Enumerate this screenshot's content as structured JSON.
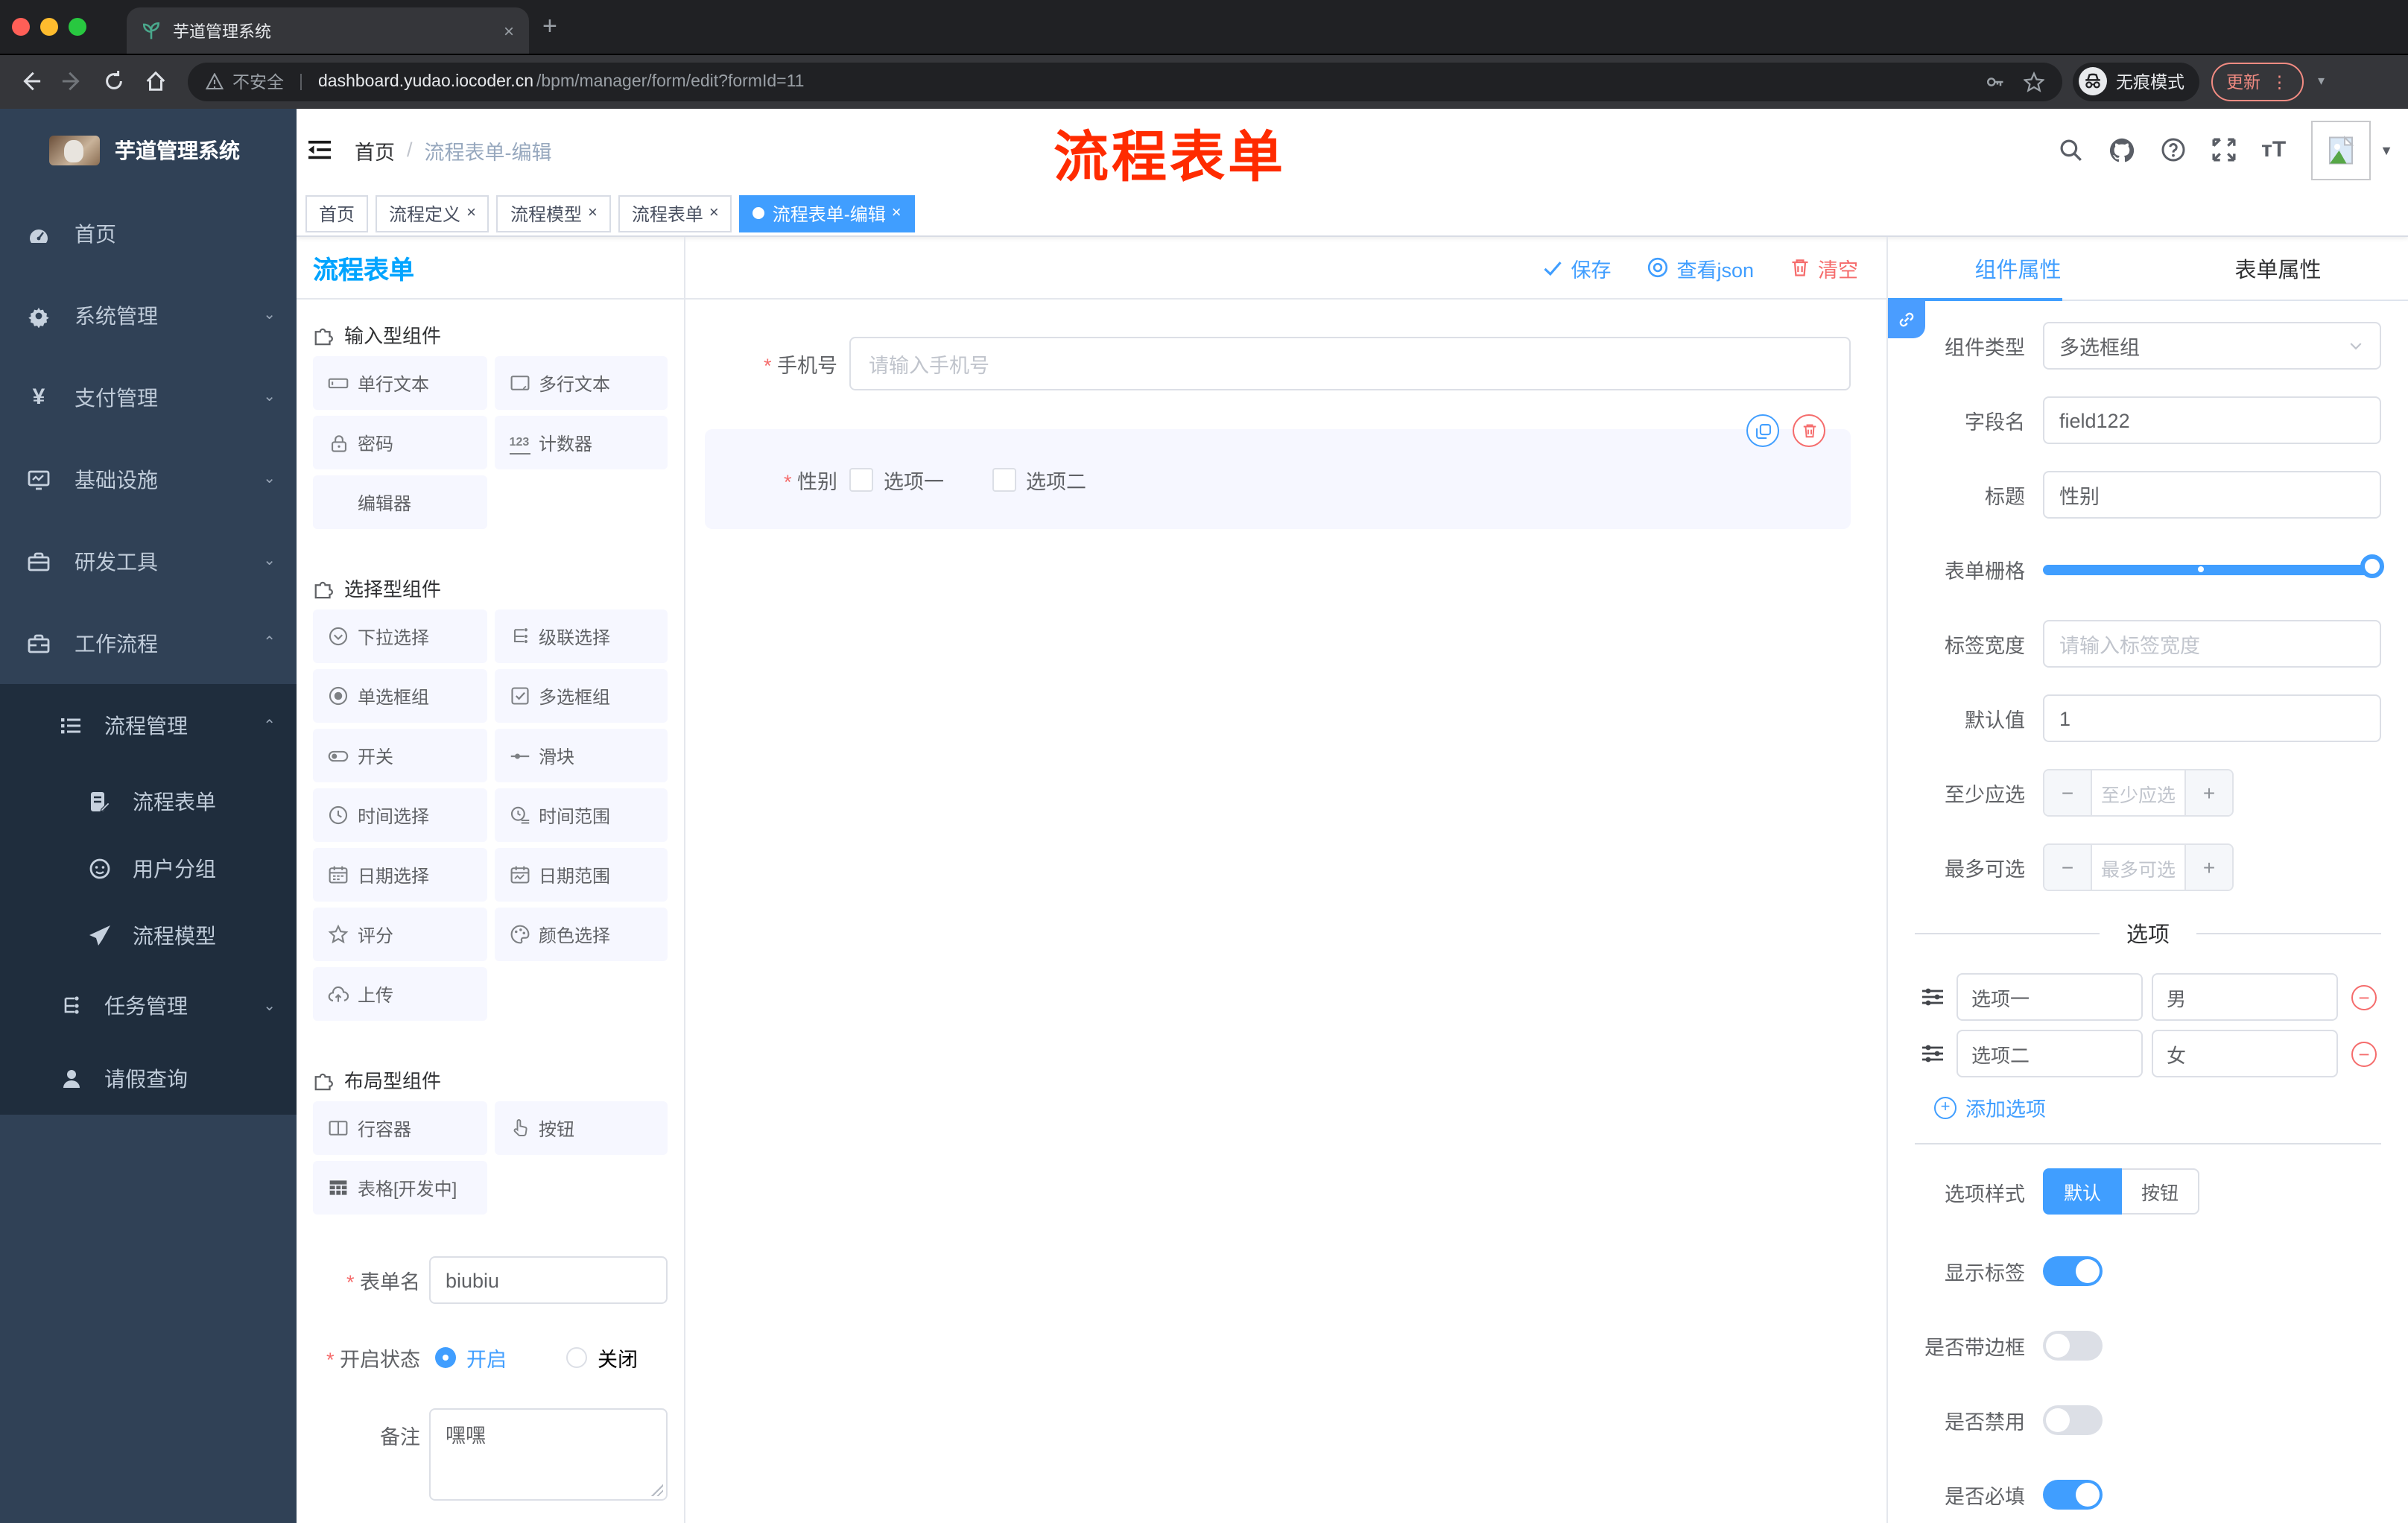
{
  "colors": {
    "primary": "#409eff",
    "danger": "#f56c6c",
    "panel_title": "#01a4ff",
    "annotation": "#ff2b00",
    "sidebar_bg": "#304156",
    "submenu_bg": "#1f2d3d",
    "tag_active": "#409eff"
  },
  "browser": {
    "tab_title": "芋道管理系统",
    "close_tab": "×",
    "new_tab": "+",
    "security": "不安全",
    "url_host": "dashboard.yudao.iocoder.cn",
    "url_path": "/bpm/manager/form/edit?formId=11",
    "incognito": "无痕模式",
    "update": "更新",
    "menu_dots": "⋮",
    "chevron": "▾"
  },
  "annotation": "流程表单",
  "app_header": {
    "breadcrumb_home": "首页",
    "breadcrumb_sep": "/",
    "breadcrumb_current": "流程表单-编辑"
  },
  "sidebar": {
    "logo_title": "芋道管理系统",
    "items": [
      {
        "label": "首页"
      },
      {
        "label": "系统管理"
      },
      {
        "label": "支付管理"
      },
      {
        "label": "基础设施"
      },
      {
        "label": "研发工具"
      },
      {
        "label": "工作流程"
      }
    ],
    "sub": {
      "parent": "流程管理",
      "children": [
        {
          "label": "流程表单"
        },
        {
          "label": "用户分组"
        },
        {
          "label": "流程模型"
        }
      ],
      "task": "任务管理",
      "leave": "请假查询"
    }
  },
  "tags": [
    {
      "label": "首页",
      "closable": false,
      "active": false
    },
    {
      "label": "流程定义",
      "closable": true,
      "active": false
    },
    {
      "label": "流程模型",
      "closable": true,
      "active": false
    },
    {
      "label": "流程表单",
      "closable": true,
      "active": false
    },
    {
      "label": "流程表单-编辑",
      "closable": true,
      "active": true
    }
  ],
  "left_panel": {
    "title": "流程表单",
    "sections": [
      {
        "title": "输入型组件",
        "items": [
          {
            "label": "单行文本"
          },
          {
            "label": "多行文本"
          },
          {
            "label": "密码"
          },
          {
            "label": "计数器"
          },
          {
            "label": "编辑器"
          }
        ]
      },
      {
        "title": "选择型组件",
        "items": [
          {
            "label": "下拉选择"
          },
          {
            "label": "级联选择"
          },
          {
            "label": "单选框组"
          },
          {
            "label": "多选框组"
          },
          {
            "label": "开关"
          },
          {
            "label": "滑块"
          },
          {
            "label": "时间选择"
          },
          {
            "label": "时间范围"
          },
          {
            "label": "日期选择"
          },
          {
            "label": "日期范围"
          },
          {
            "label": "评分"
          },
          {
            "label": "颜色选择"
          },
          {
            "label": "上传"
          }
        ]
      },
      {
        "title": "布局型组件",
        "items": [
          {
            "label": "行容器"
          },
          {
            "label": "按钮"
          },
          {
            "label": "表格[开发中]"
          }
        ]
      }
    ],
    "form": {
      "name_label": "表单名",
      "name_value": "biubiu",
      "status_label": "开启状态",
      "status_on": "开启",
      "status_off": "关闭",
      "remark_label": "备注",
      "remark_value": "嘿嘿"
    }
  },
  "canvas": {
    "actions": {
      "save": "保存",
      "view_json": "查看json",
      "clear": "清空"
    },
    "phone": {
      "label": "手机号",
      "placeholder": "请输入手机号"
    },
    "gender": {
      "label": "性别",
      "option1": "选项一",
      "option2": "选项二"
    }
  },
  "right_panel": {
    "tab_component": "组件属性",
    "tab_form": "表单属性",
    "rows": {
      "type_label": "组件类型",
      "type_value": "多选框组",
      "field_label": "字段名",
      "field_value": "field122",
      "title_label": "标题",
      "title_value": "性别",
      "grid_label": "表单栅格",
      "width_label": "标签宽度",
      "width_placeholder": "请输入标签宽度",
      "default_label": "默认值",
      "default_value": "1",
      "min_label": "至少应选",
      "min_placeholder": "至少应选",
      "max_label": "最多可选",
      "max_placeholder": "最多可选"
    },
    "options_title": "选项",
    "option_rows": [
      {
        "label": "选项一",
        "value": "男"
      },
      {
        "label": "选项二",
        "value": "女"
      }
    ],
    "add_option": "添加选项",
    "style_label": "选项样式",
    "style_default": "默认",
    "style_button": "按钮",
    "toggles": {
      "show_label": {
        "label": "显示标签",
        "on": true
      },
      "border": {
        "label": "是否带边框",
        "on": false
      },
      "disabled": {
        "label": "是否禁用",
        "on": false
      },
      "required": {
        "label": "是否必填",
        "on": true
      }
    }
  }
}
